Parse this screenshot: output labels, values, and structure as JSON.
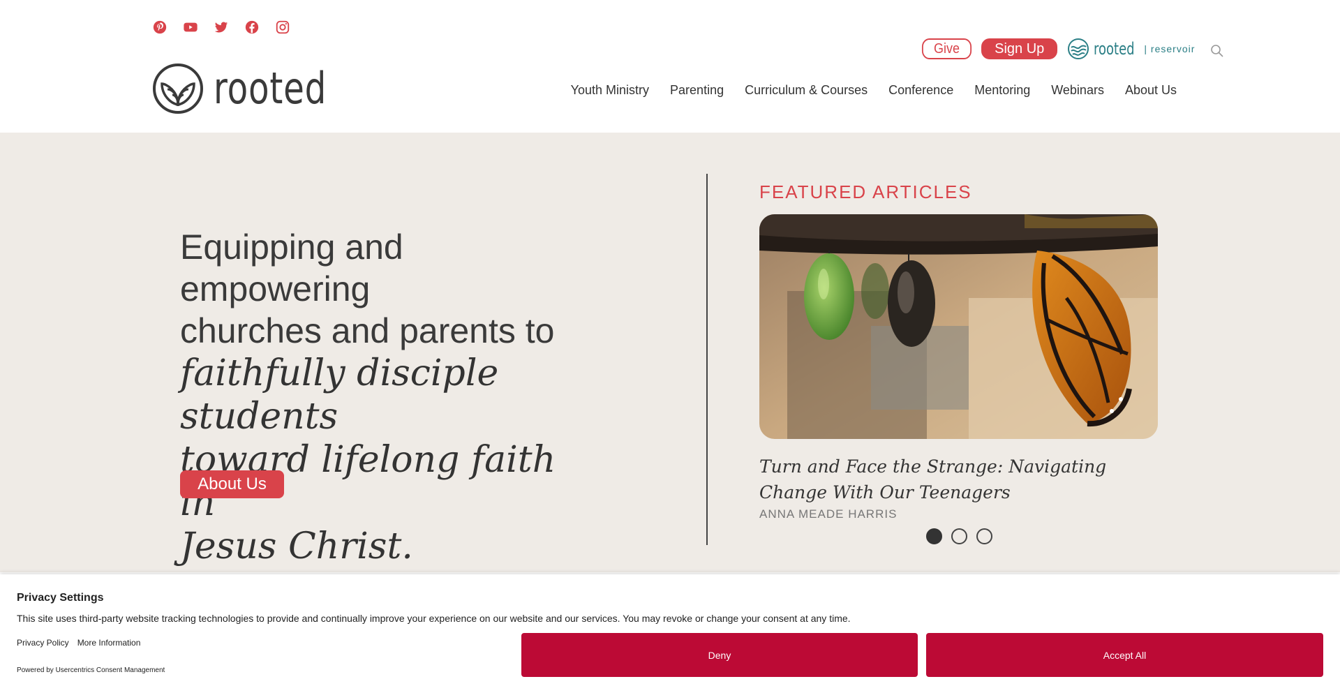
{
  "header": {
    "social_icons": [
      "pinterest-icon",
      "youtube-icon",
      "twitter-icon",
      "facebook-icon",
      "instagram-icon"
    ],
    "logo_text": "rooted",
    "give_label": "Give",
    "signup_label": "Sign Up",
    "reservoir_word": "rooted",
    "reservoir_sub": "| reservoir",
    "nav": [
      "Youth Ministry",
      "Parenting",
      "Curriculum & Courses",
      "Conference",
      "Mentoring",
      "Webinars",
      "About Us"
    ]
  },
  "hero": {
    "plain_line_1": "Equipping and empowering",
    "plain_line_2": "churches and parents to",
    "italic_line_1": "faithfully disciple students",
    "italic_line_2": "toward lifelong faith in",
    "italic_line_3": "Jesus Christ.",
    "about_button": "About Us"
  },
  "featured": {
    "heading": "FEATURED ARTICLES",
    "article_title": "Turn and Face the Strange: Navigating Change With Our Teenagers",
    "author": "ANNA MEADE HARRIS",
    "slides_total": 3,
    "active_slide": 1
  },
  "privacy": {
    "title": "Privacy Settings",
    "description": "This site uses third-party website tracking technologies to provide and continually improve your experience on our website and our services. You may revoke or change your consent at any time.",
    "privacy_policy_link": "Privacy Policy",
    "more_info_link": "More Information",
    "powered_by": "Powered by Usercentrics Consent Management",
    "deny_label": "Deny",
    "accept_label": "Accept All"
  },
  "colors": {
    "brand_red": "#d9434a",
    "hero_bg": "#efebe6",
    "consent_red": "#bc0a35",
    "reservoir_teal": "#2b7f86"
  }
}
